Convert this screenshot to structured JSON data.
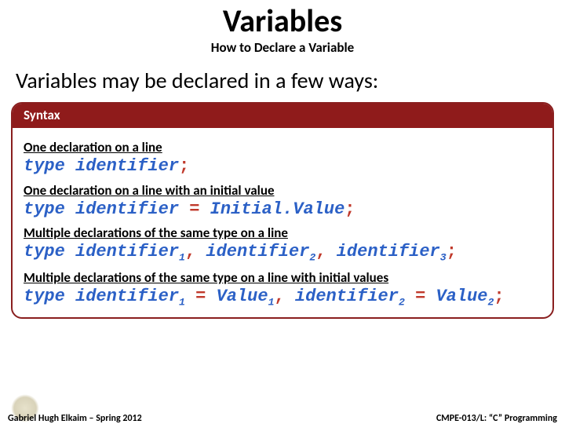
{
  "title": "Variables",
  "subtitle": "How to Declare a Variable",
  "lead": "Variables may be declared in a few ways:",
  "syntax_header": "Syntax",
  "sections": {
    "s1": {
      "label": "One declaration on a line"
    },
    "s2": {
      "label": "One declaration on a line with an initial value"
    },
    "s3": {
      "label": "Multiple declarations of the same type on a line"
    },
    "s4": {
      "label": "Multiple declarations of the same type on a line with initial values"
    }
  },
  "tokens": {
    "type": "type",
    "identifier": "identifier",
    "initial_value": "Initial.Value",
    "value": "Value",
    "eq": " = ",
    "comma": ", ",
    "semi": ";",
    "n1": "1",
    "n2": "2",
    "n3": "3"
  },
  "footer": {
    "left": "Gabriel Hugh Elkaim – Spring 2012",
    "right": "CMPE-013/L: “C” Programming"
  }
}
